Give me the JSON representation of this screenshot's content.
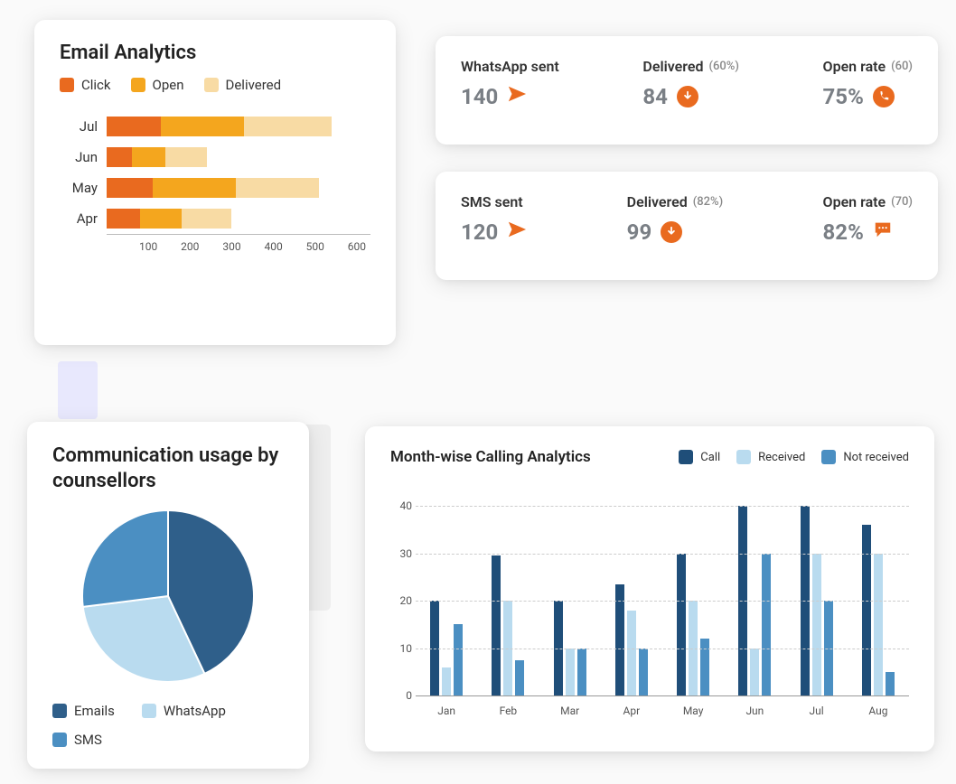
{
  "colors": {
    "click": "#e96a1f",
    "open": "#f4a61e",
    "delivered": "#f8dba4",
    "pie_emails": "#2f5f8a",
    "pie_whatsapp": "#b9dbef",
    "pie_sms": "#4b8fc2",
    "bar_call": "#1f4e79",
    "bar_received": "#b9dbef",
    "bar_notreceived": "#4b8fc2"
  },
  "email": {
    "title": "Email Analytics",
    "legend": {
      "click": "Click",
      "open": "Open",
      "delivered": "Delivered"
    },
    "xmax": 650
  },
  "whatsapp": {
    "sent_label": "WhatsApp sent",
    "sent_value": "140",
    "delivered_label": "Delivered",
    "delivered_pct": "(60%)",
    "delivered_value": "84",
    "open_label": "Open rate",
    "open_ct": "(60)",
    "open_value": "75%"
  },
  "sms": {
    "sent_label": "SMS sent",
    "sent_value": "120",
    "delivered_label": "Delivered",
    "delivered_pct": "(82%)",
    "delivered_value": "99",
    "open_label": "Open rate",
    "open_ct": "(70)",
    "open_value": "82%"
  },
  "pie": {
    "title": "Communication usage by counsellors",
    "legend": {
      "emails": "Emails",
      "whatsapp": "WhatsApp",
      "sms": "SMS"
    }
  },
  "calls": {
    "title": "Month-wise Calling Analytics",
    "legend": {
      "call": "Call",
      "received": "Received",
      "notreceived": "Not received"
    },
    "ymax": 45
  },
  "chart_data": [
    {
      "id": "email_analytics",
      "type": "bar",
      "orientation": "horizontal",
      "stacked": true,
      "title": "Email Analytics",
      "xlabel": "",
      "ylabel": "",
      "xlim": [
        0,
        650
      ],
      "xticks": [
        100,
        200,
        300,
        400,
        500,
        600
      ],
      "categories": [
        "Jul",
        "Jun",
        "May",
        "Apr"
      ],
      "series": [
        {
          "name": "Click",
          "color": "#e96a1f",
          "values": [
            130,
            60,
            110,
            80
          ]
        },
        {
          "name": "Open",
          "color": "#f4a61e",
          "values": [
            200,
            80,
            200,
            100
          ]
        },
        {
          "name": "Delivered",
          "color": "#f8dba4",
          "values": [
            210,
            100,
            200,
            120
          ]
        }
      ]
    },
    {
      "id": "communication_usage",
      "type": "pie",
      "title": "Communication usage by counsellors",
      "series": [
        {
          "name": "Emails",
          "value": 43,
          "color": "#2f5f8a"
        },
        {
          "name": "WhatsApp",
          "value": 30,
          "color": "#b9dbef"
        },
        {
          "name": "SMS",
          "value": 27,
          "color": "#4b8fc2"
        }
      ]
    },
    {
      "id": "monthwise_calling",
      "type": "bar",
      "orientation": "vertical",
      "grouped": true,
      "title": "Month-wise Calling Analytics",
      "xlabel": "",
      "ylabel": "",
      "ylim": [
        0,
        45
      ],
      "yticks": [
        0,
        10,
        20,
        30,
        40
      ],
      "categories": [
        "Jan",
        "Feb",
        "Mar",
        "Apr",
        "May",
        "Jun",
        "Jul",
        "Aug"
      ],
      "series": [
        {
          "name": "Call",
          "color": "#1f4e79",
          "values": [
            20,
            29.5,
            20,
            23.5,
            30,
            40,
            40,
            36
          ]
        },
        {
          "name": "Received",
          "color": "#b9dbef",
          "values": [
            6,
            20,
            10,
            18,
            20,
            10,
            30,
            30
          ]
        },
        {
          "name": "Not received",
          "color": "#4b8fc2",
          "values": [
            15,
            7.5,
            10,
            10,
            12,
            30,
            20,
            5
          ]
        }
      ]
    }
  ]
}
